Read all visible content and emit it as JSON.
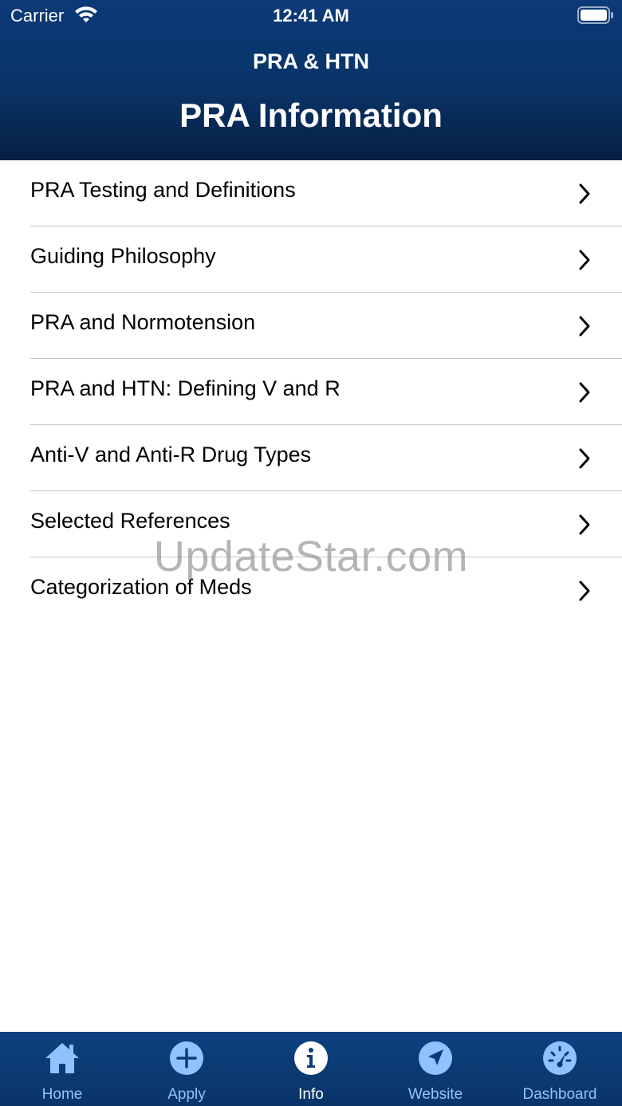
{
  "status_bar": {
    "carrier": "Carrier",
    "time": "12:41 AM"
  },
  "nav": {
    "subtitle": "PRA & HTN",
    "title": "PRA Information"
  },
  "menu": {
    "items": [
      {
        "label": "PRA Testing and Definitions"
      },
      {
        "label": "Guiding Philosophy"
      },
      {
        "label": "PRA and Normotension"
      },
      {
        "label": "PRA and HTN: Defining V and R"
      },
      {
        "label": "Anti-V and Anti-R Drug Types"
      },
      {
        "label": "Selected References"
      },
      {
        "label": "Categorization of Meds"
      }
    ]
  },
  "watermark": "UpdateStar.com",
  "tab_bar": {
    "active": "Info",
    "items": [
      {
        "label": "Home",
        "icon": "home-icon"
      },
      {
        "label": "Apply",
        "icon": "plus-circle-icon"
      },
      {
        "label": "Info",
        "icon": "info-circle-icon"
      },
      {
        "label": "Website",
        "icon": "navigation-arrow-icon"
      },
      {
        "label": "Dashboard",
        "icon": "speedometer-icon"
      }
    ]
  },
  "colors": {
    "header_top": "#0b3a78",
    "header_bottom": "#061f42",
    "tab_inactive": "#8fc3ff",
    "tab_active": "#ffffff",
    "divider": "#c8c8cc"
  }
}
